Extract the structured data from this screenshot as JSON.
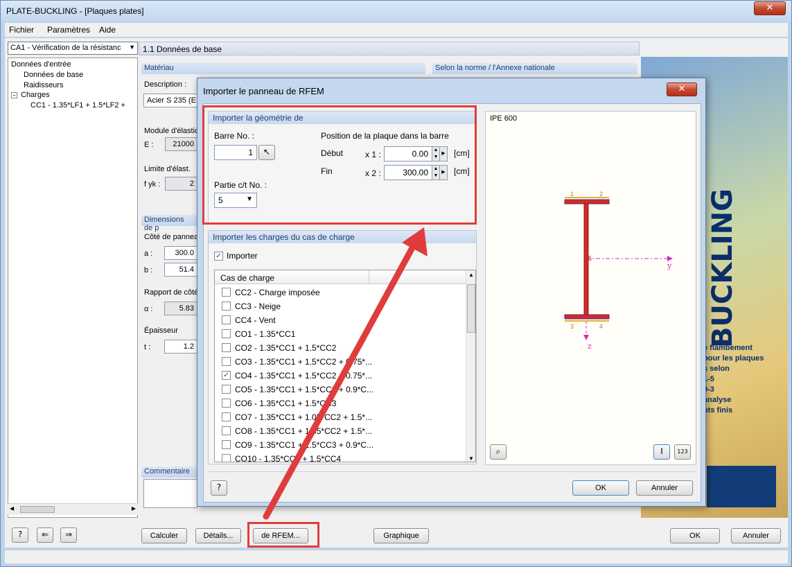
{
  "window": {
    "title": "PLATE-BUCKLING - [Plaques plates]"
  },
  "menu": [
    "Fichier",
    "Paramètres",
    "Aide"
  ],
  "case_selector": "CA1 - Vérification de la résistanc",
  "tree": {
    "root": "Données d'entrée",
    "items": [
      "Données de base",
      "Raidisseurs",
      "Charges"
    ],
    "sub": "CC1 - 1.35*LF1 + 1.5*LF2 +"
  },
  "section_title": "1.1 Données de base",
  "material": {
    "header": "Matériau",
    "description_label": "Description :",
    "description_value": "Acier S 235 (E",
    "elastic_label": "Module d'élastic",
    "E_label": "E :",
    "E_value": "21000",
    "yield_label": "Limite d'élast.",
    "fyk_label": "f yk :",
    "fyk_value": "2"
  },
  "norm": {
    "header": "Selon la norme / l'Annexe nationale"
  },
  "dimensions": {
    "header": "Dimensions de p",
    "side_label": "Côté de panneau",
    "a_label": "a :",
    "a_value": "300.0",
    "b_label": "b :",
    "b_value": "51.4",
    "ratio_label": "Rapport de côté",
    "alpha_label": "α :",
    "alpha_value": "5.83",
    "thickness_label": "Épaisseur",
    "t_label": "t :",
    "t_value": "1.2"
  },
  "comment": {
    "header": "Commentaire"
  },
  "banner": {
    "title": "BUCKLING",
    "lines": [
      "e flambement",
      "pour les plaques",
      "s selon",
      "1-5",
      "0-3",
      "analyse",
      "nts finis"
    ]
  },
  "bottom": {
    "calc": "Calculer",
    "details": "Détails...",
    "from_rfem": "de RFEM...",
    "graph": "Graphique",
    "ok": "OK",
    "cancel": "Annuler"
  },
  "dialog": {
    "title": "Importer le panneau de RFEM",
    "geometry": {
      "header": "Importer la géométrie de",
      "member_label": "Barre No. :",
      "member_value": "1",
      "position_label": "Position de la plaque dans la barre",
      "start_label": "Début",
      "x1_label": "x 1 :",
      "x1_value": "0.00",
      "end_label": "Fin",
      "x2_label": "x 2 :",
      "x2_value": "300.00",
      "unit": "[cm]",
      "part_label": "Partie c/t No. :",
      "part_value": "5"
    },
    "loads": {
      "header": "Importer les charges du cas de charge",
      "import_label": "Importer",
      "import_checked": true,
      "column": "Cas de charge",
      "items": [
        {
          "label": "CC2 - Charge imposée",
          "checked": false
        },
        {
          "label": "CC3 - Neige",
          "checked": false
        },
        {
          "label": "CC4 - Vent",
          "checked": false
        },
        {
          "label": "CO1 - 1.35*CC1",
          "checked": false
        },
        {
          "label": "CO2 - 1.35*CC1 + 1.5*CC2",
          "checked": false
        },
        {
          "label": "CO3 - 1.35*CC1 + 1.5*CC2 + 0.75*...",
          "checked": false
        },
        {
          "label": "CO4 - 1.35*CC1 + 1.5*CC2 + 0.75*...",
          "checked": true
        },
        {
          "label": "CO5 - 1.35*CC1 + 1.5*CC2 + 0.9*C...",
          "checked": false
        },
        {
          "label": "CO6 - 1.35*CC1 + 1.5*CC3",
          "checked": false
        },
        {
          "label": "CO7 - 1.35*CC1 + 1.05*CC2 + 1.5*...",
          "checked": false
        },
        {
          "label": "CO8 - 1.35*CC1 + 1.05*CC2 + 1.5*...",
          "checked": false
        },
        {
          "label": "CO9 - 1.35*CC1 + 1.5*CC3 + 0.9*C...",
          "checked": false
        },
        {
          "label": "CO10 - 1.35*CC1 + 1.5*CC4",
          "checked": false
        }
      ]
    },
    "section": {
      "name": "IPE 600",
      "axis_y": "y",
      "axis_z": "z",
      "n1": "1",
      "n2": "2",
      "n3": "3",
      "n4": "4",
      "n5": "5"
    },
    "ok": "OK",
    "cancel": "Annuler"
  },
  "colors": {
    "highlight": "#e03c3c",
    "section": "#d42a2a",
    "axis": "#d62ad0"
  }
}
